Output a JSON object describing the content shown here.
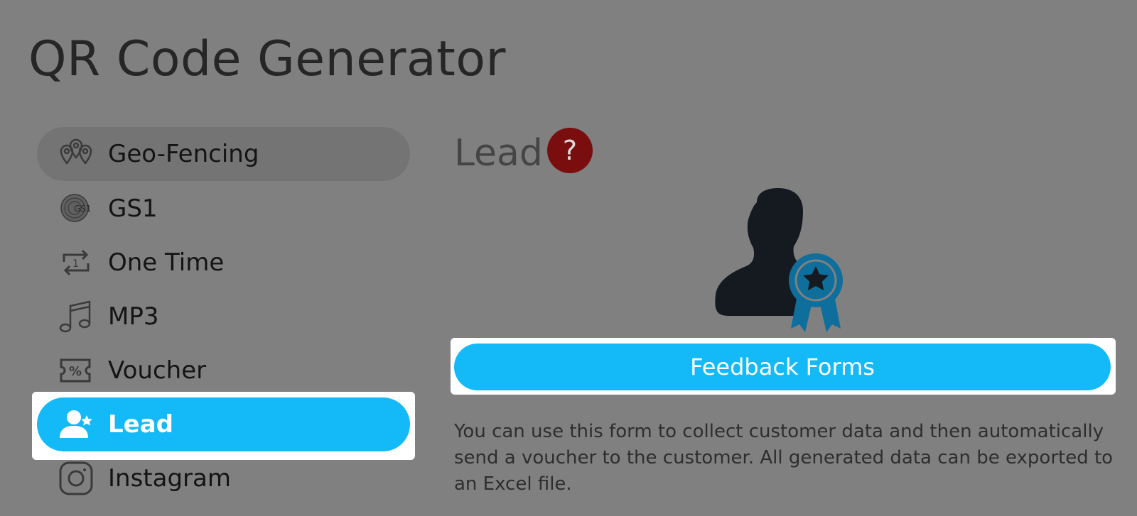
{
  "page": {
    "title": "QR Code Generator"
  },
  "sidebar": {
    "items": [
      {
        "label": "Geo-Fencing",
        "icon": "geo-fencing-icon",
        "state": "hover"
      },
      {
        "label": "GS1",
        "icon": "gs1-icon",
        "icon_text": "GS1",
        "state": "normal"
      },
      {
        "label": "One Time",
        "icon": "repeat-one-icon",
        "icon_text": "1",
        "state": "normal"
      },
      {
        "label": "MP3",
        "icon": "music-note-icon",
        "state": "normal"
      },
      {
        "label": "Voucher",
        "icon": "voucher-icon",
        "icon_text": "%",
        "state": "normal"
      },
      {
        "label": "Lead",
        "icon": "user-star-icon",
        "state": "active"
      },
      {
        "label": "Instagram",
        "icon": "instagram-icon",
        "state": "normal"
      }
    ]
  },
  "main": {
    "heading": "Lead",
    "help_icon_text": "?",
    "illustration": "person-award-icon",
    "button_label": "Feedback Forms",
    "description": "You can use this form to collect customer data and then automatically send a voucher to the customer. All generated data can be exported to an Excel file."
  },
  "colors": {
    "background": "#808080",
    "accent": "#14baf7",
    "help": "#7a0d0d",
    "award": "#0e6f9c",
    "silhouette": "#141a1f"
  }
}
